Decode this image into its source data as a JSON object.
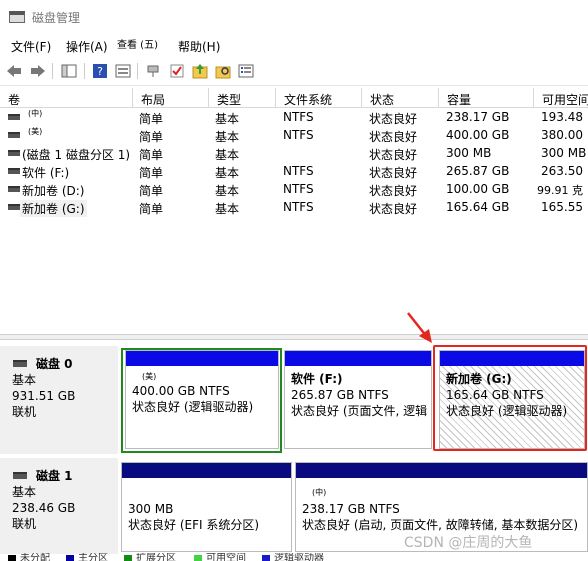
{
  "window": {
    "title": "磁盘管理"
  },
  "menu": [
    "文件(F)",
    "操作(A)",
    "查看 (五)",
    "帮助(H)"
  ],
  "toolbar": {
    "icons": [
      "back-arrow-icon",
      "forward-arrow-icon",
      "console-tree-icon",
      "help-icon",
      "properties-icon",
      "connect-icon",
      "check-icon",
      "new-folder-icon",
      "search-folder-icon",
      "list-icon"
    ]
  },
  "volume_list": {
    "columns": [
      "卷",
      "布局",
      "类型",
      "文件系统",
      "状态",
      "容量",
      "可用空间"
    ],
    "rows": [
      [
        "(中)",
        "简单",
        "基本",
        "NTFS",
        "状态良好",
        "238.17 GB",
        "193.48"
      ],
      [
        "(美)",
        "简单",
        "基本",
        "NTFS",
        "状态良好",
        "400.00 GB",
        "380.00"
      ],
      [
        "(磁盘 1 磁盘分区 1)",
        "简单",
        "基本",
        "",
        "状态良好",
        "300 MB",
        "300 MB"
      ],
      [
        "软件 (F:)",
        "简单",
        "基本",
        "NTFS",
        "状态良好",
        "265.87 GB",
        "263.50"
      ],
      [
        "新加卷 (D:)",
        "简单",
        "基本",
        "NTFS",
        "状态良好",
        "100.00 GB",
        "99.91 克"
      ],
      [
        "新加卷 (G:)",
        "简单",
        "基本",
        "NTFS",
        "状态良好",
        "165.64 GB",
        "165.55"
      ]
    ]
  },
  "disks": [
    {
      "name": "磁盘 0",
      "type": "基本",
      "size": "931.51 GB",
      "status": "联机",
      "partitions": [
        {
          "title": "(美)",
          "size": "400.00 GB NTFS",
          "status": "状态良好 (逻辑驱动器)"
        },
        {
          "title": "软件  (F:)",
          "size": "265.87 GB NTFS",
          "status": "状态良好 (页面文件, 逻辑"
        },
        {
          "title": "新加卷  (G:)",
          "size": "165.64 GB NTFS",
          "status": "状态良好 (逻辑驱动器)"
        }
      ]
    },
    {
      "name": "磁盘 1",
      "type": "基本",
      "size": "238.46 GB",
      "status": "联机",
      "partitions": [
        {
          "title": "",
          "size": "300 MB",
          "status": "状态良好 (EFI 系统分区)"
        },
        {
          "title": "(中)",
          "size": "238.17 GB NTFS",
          "status": "状态良好 (启动, 页面文件, 故障转储, 基本数据分区)"
        }
      ]
    }
  ],
  "legend": [
    {
      "label": "未分配",
      "color": "#000000"
    },
    {
      "label": "主分区",
      "color": "#0000a0"
    },
    {
      "label": "扩展分区",
      "color": "#138b13"
    },
    {
      "label": "可用空间",
      "color": "#44d244"
    },
    {
      "label": "逻辑驱动器",
      "color": "#1a1acc"
    }
  ],
  "colors": {
    "primary_partition": "#0a0a80",
    "logical_drive": "#0a0ae6",
    "extended_partition": "#1f8a1f",
    "highlight": "#e3271f"
  },
  "watermark": "CSDN @庄周的大鱼"
}
